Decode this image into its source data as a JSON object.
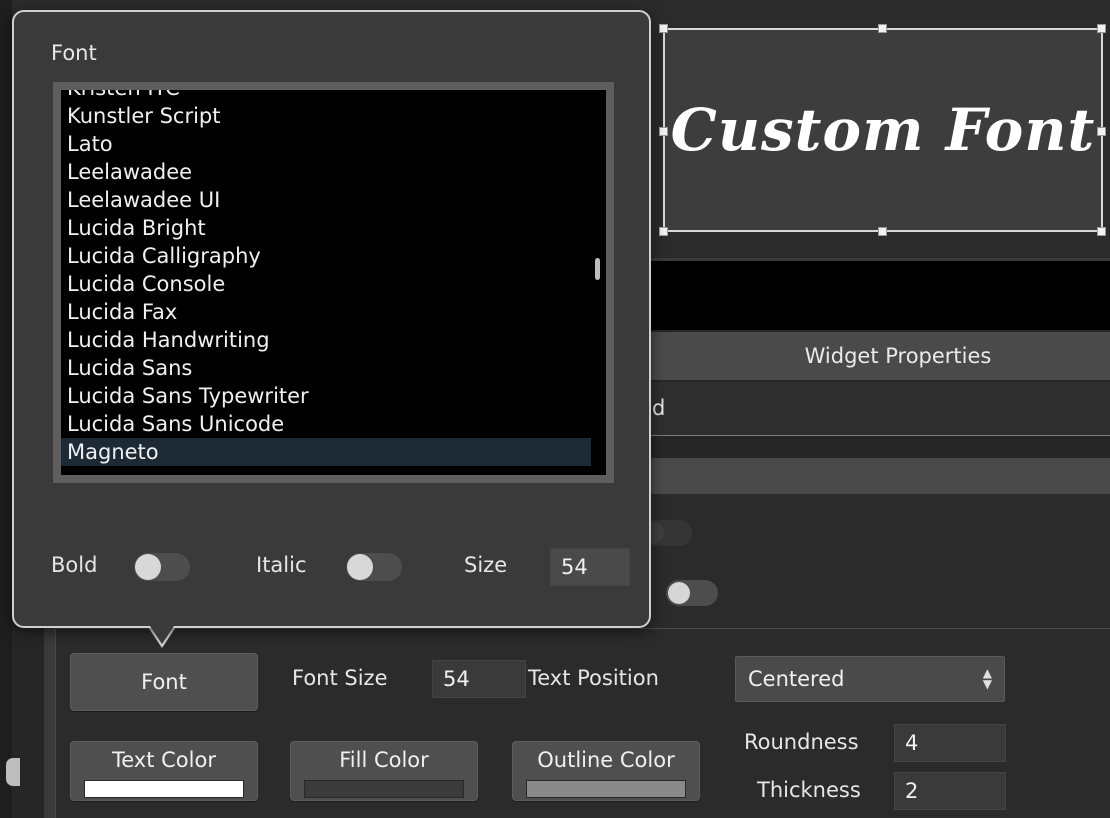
{
  "widget": {
    "preview_text": "Custom Font"
  },
  "properties": {
    "header": "Widget Properties",
    "row1_partial_text": "d"
  },
  "font_popover": {
    "title": "Font",
    "fonts": [
      "Kristen ITC",
      "Kunstler Script",
      "Lato",
      "Leelawadee",
      "Leelawadee UI",
      "Lucida Bright",
      "Lucida Calligraphy",
      "Lucida Console",
      "Lucida Fax",
      "Lucida Handwriting",
      "Lucida Sans",
      "Lucida Sans Typewriter",
      "Lucida Sans Unicode",
      "Magneto"
    ],
    "selected_font": "Magneto",
    "bold_label": "Bold",
    "bold_on": false,
    "italic_label": "Italic",
    "italic_on": false,
    "size_label": "Size",
    "size_value": "54"
  },
  "bottom": {
    "font_button": "Font",
    "font_size_label": "Font Size",
    "font_size_value": "54",
    "text_position_label": "Text Position",
    "text_position_value": "Centered",
    "text_color_label": "Text Color",
    "text_color": "#ffffff",
    "fill_color_label": "Fill Color",
    "fill_color": "#3b3b3b",
    "outline_color_label": "Outline Color",
    "outline_color": "#8a8a8a",
    "roundness_label": "Roundness",
    "roundness_value": "4",
    "thickness_label": "Thickness",
    "thickness_value": "2"
  }
}
